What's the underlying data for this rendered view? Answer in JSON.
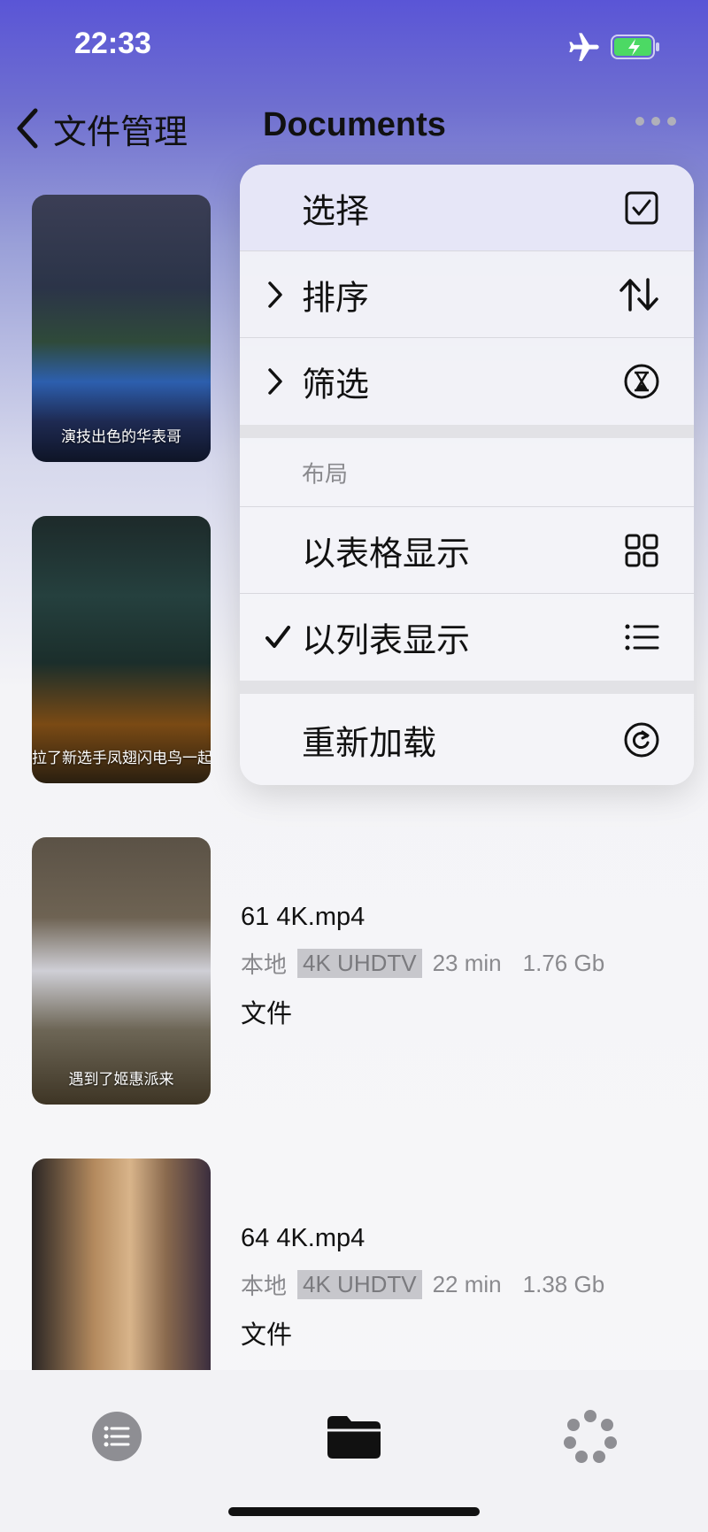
{
  "status": {
    "time": "22:33"
  },
  "nav": {
    "back_label": "文件管理",
    "title": "Documents"
  },
  "files": [
    {
      "caption": "演技出色的华表哥",
      "name": "",
      "source": "",
      "quality": "",
      "duration": "",
      "size": "",
      "kind": ""
    },
    {
      "caption": "拉了新选手凤翅闪电鸟一起",
      "name": "",
      "source": "",
      "quality": "",
      "duration": "",
      "size": "",
      "kind": ""
    },
    {
      "caption": "遇到了姬惠派来",
      "name": "61 4K.mp4",
      "source": "本地",
      "quality": "4K UHDTV",
      "duration": "23 min",
      "size": "1.76 Gb",
      "kind": "文件"
    },
    {
      "caption": "",
      "name": "64 4K.mp4",
      "source": "本地",
      "quality": "4K UHDTV",
      "duration": "22 min",
      "size": "1.38 Gb",
      "kind": "文件"
    }
  ],
  "menu": {
    "select": "选择",
    "sort": "排序",
    "filter": "筛选",
    "layout_header": "布局",
    "grid": "以表格显示",
    "list": "以列表显示",
    "reload": "重新加载",
    "checked": "list"
  },
  "tabs": [
    {
      "icon": "list-icon"
    },
    {
      "icon": "folder-icon",
      "active": true
    },
    {
      "icon": "dots-cluster-icon"
    }
  ],
  "colors": {
    "accent": "#5a55d6",
    "tab_gray": "#8e8e93"
  }
}
